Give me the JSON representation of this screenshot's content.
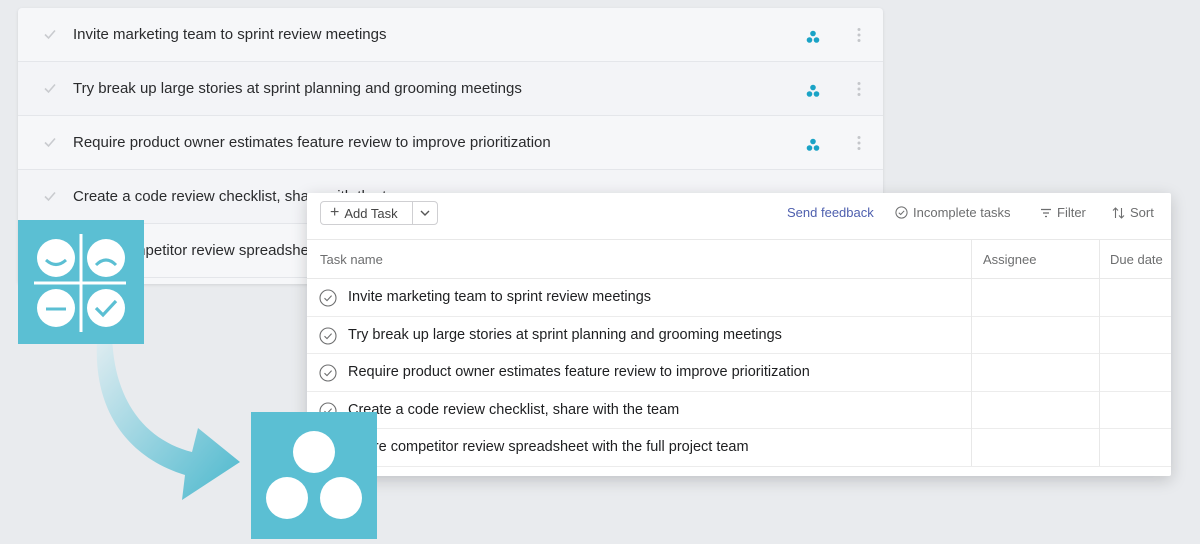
{
  "back_list": {
    "items": [
      {
        "label": "Invite marketing team to sprint review meetings"
      },
      {
        "label": "Try break up large stories at sprint planning and grooming meetings"
      },
      {
        "label": "Require product owner estimates feature review to improve prioritization"
      },
      {
        "label": "Create a code review checklist, share with the team"
      },
      {
        "label": "Share competitor review spreadsheet with the full project team"
      }
    ]
  },
  "toolbar": {
    "add_task_label": "Add Task",
    "send_feedback_label": "Send feedback",
    "incomplete_tasks_label": "Incomplete tasks",
    "filter_label": "Filter",
    "sort_label": "Sort"
  },
  "table": {
    "columns": [
      "Task name",
      "Assignee",
      "Due date"
    ],
    "rows": [
      {
        "name": "Invite marketing team to sprint review meetings"
      },
      {
        "name": "Try break up large stories at sprint planning and grooming meetings"
      },
      {
        "name": "Require product owner estimates feature review to improve prioritization"
      },
      {
        "name": "Create a code review checklist, share with the team"
      },
      {
        "name": "Share competitor review spreadsheet with the full project team"
      }
    ]
  },
  "icons": {
    "retro_logo": "retrospective-faces-icon",
    "team_logo": "team-three-dots-icon",
    "arrow": "curved-arrow-icon"
  },
  "colors": {
    "tile": "#5bbfd3",
    "accent_link": "#4e5fae",
    "team_dots": "#1aa3c6"
  }
}
